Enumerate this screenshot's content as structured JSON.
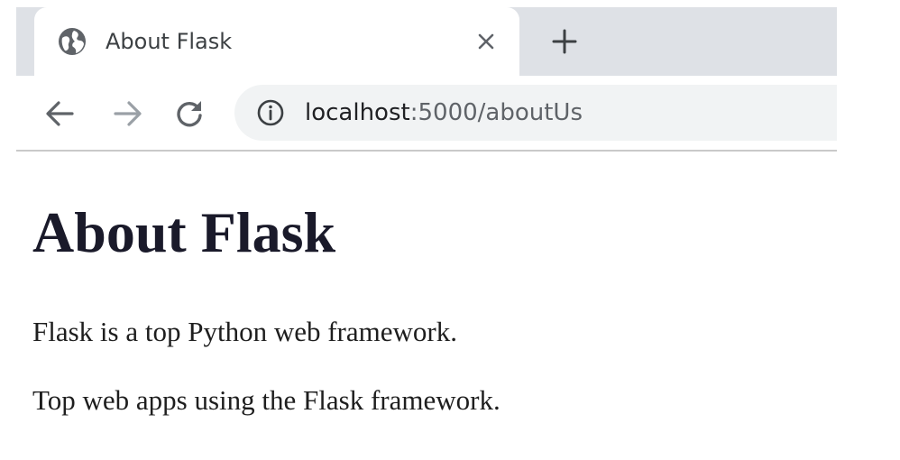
{
  "browser": {
    "tab": {
      "title": "About Flask",
      "favicon": "globe-icon",
      "close_icon": "close-icon"
    },
    "new_tab_icon": "plus-icon",
    "toolbar": {
      "back_icon": "arrow-left-icon",
      "forward_icon": "arrow-right-icon",
      "reload_icon": "reload-icon",
      "site_info_icon": "info-icon"
    },
    "address_bar": {
      "host": "localhost",
      "path": ":5000/aboutUs"
    }
  },
  "page": {
    "heading": "About Flask",
    "paragraphs": [
      "Flask is a top Python web framework.",
      "Top web apps using the Flask framework."
    ]
  },
  "colors": {
    "tabstrip_bg": "#dee1e6",
    "omnibox_bg": "#f1f3f4",
    "icon": "#5f6368",
    "icon_disabled": "#9aa0a6"
  }
}
